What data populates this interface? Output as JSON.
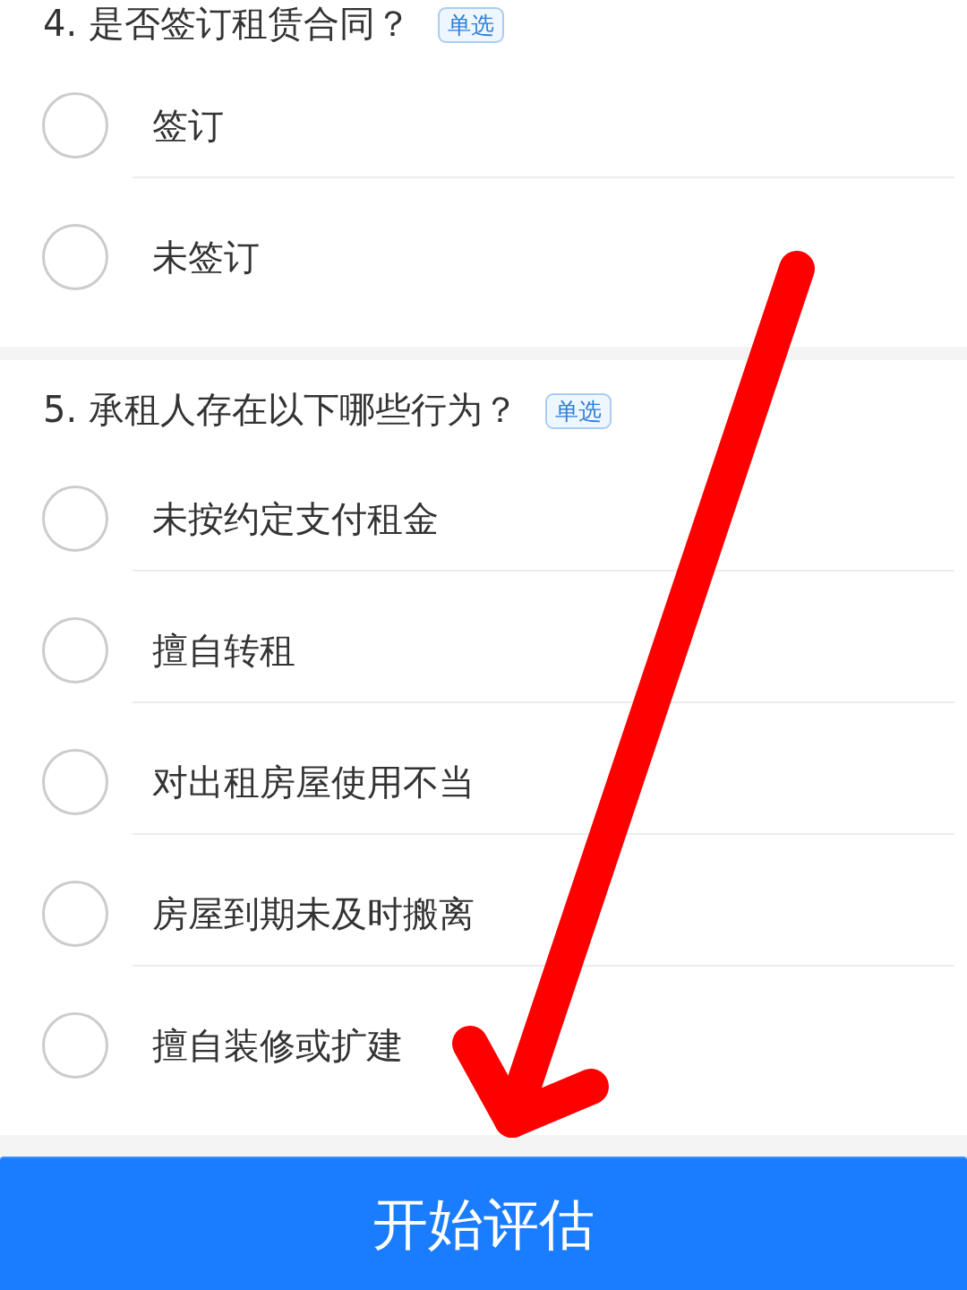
{
  "questions": [
    {
      "title": "4. 是否签订租赁合同？",
      "tag": "单选",
      "options": [
        {
          "label": "签订",
          "selected": false
        },
        {
          "label": "未签订",
          "selected": false
        }
      ]
    },
    {
      "title": "5. 承租人存在以下哪些行为？",
      "tag": "单选",
      "options": [
        {
          "label": "未按约定支付租金",
          "selected": false
        },
        {
          "label": "擅自转租",
          "selected": false
        },
        {
          "label": "对出租房屋使用不当",
          "selected": false
        },
        {
          "label": "房屋到期未及时搬离",
          "selected": false
        },
        {
          "label": "擅自装修或扩建",
          "selected": false
        }
      ]
    }
  ],
  "submit_button": {
    "label": "开始评估"
  }
}
